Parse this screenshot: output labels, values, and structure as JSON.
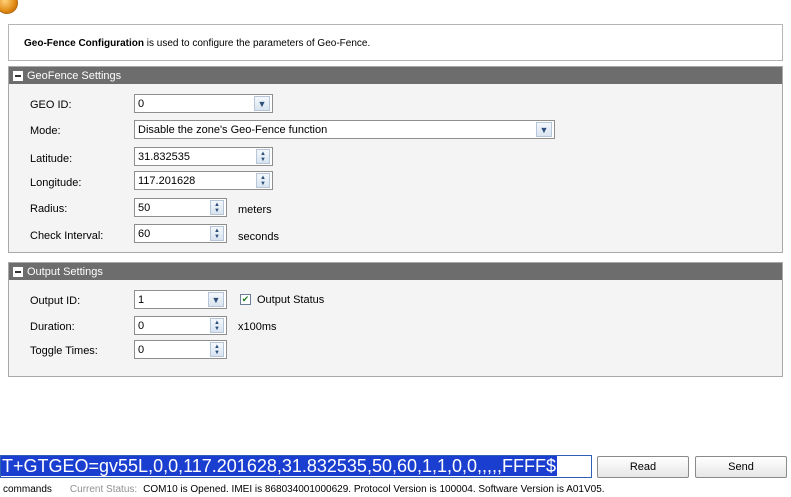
{
  "info": {
    "title_bold": "Geo-Fence Configuration",
    "description": " is used to configure the parameters of Geo-Fence."
  },
  "geofence": {
    "header": "GeoFence Settings",
    "geo_id": {
      "label": "GEO ID:",
      "value": "0"
    },
    "mode": {
      "label": "Mode:",
      "value": "Disable the zone's Geo-Fence function"
    },
    "latitude": {
      "label": "Latitude:",
      "value": "31.832535"
    },
    "longitude": {
      "label": "Longitude:",
      "value": "117.201628"
    },
    "radius": {
      "label": "Radius:",
      "value": "50",
      "unit": "meters"
    },
    "check_interval": {
      "label": "Check Interval:",
      "value": "60",
      "unit": "seconds"
    }
  },
  "output": {
    "header": "Output Settings",
    "output_id": {
      "label": "Output ID:",
      "value": "1"
    },
    "output_status": {
      "label": "Output Status",
      "checked": true
    },
    "duration": {
      "label": "Duration:",
      "value": "0",
      "unit": "x100ms"
    },
    "toggle_times": {
      "label": "Toggle Times:",
      "value": "0"
    }
  },
  "command": {
    "text": "T+GTGEO=gv55L,0,0,117.201628,31.832535,50,60,1,1,0,0,,,,,FFFF$",
    "read_label": "Read",
    "send_label": "Send"
  },
  "status": {
    "commands": "commands",
    "current_status_label": "Current Status:",
    "message": "COM10 is Opened. IMEI is 868034001000629. Protocol Version is 100004. Software Version is A01V05."
  },
  "icons": {
    "collapse": "collapse-minus-icon",
    "dropdown": "chevron-down-icon",
    "spinner": "spinner-updown-icon",
    "check": "check-icon"
  },
  "colors": {
    "section_header": "#6d6d6d",
    "section_bg": "#f4f4f4",
    "command_highlight": "#1a3fd0"
  }
}
